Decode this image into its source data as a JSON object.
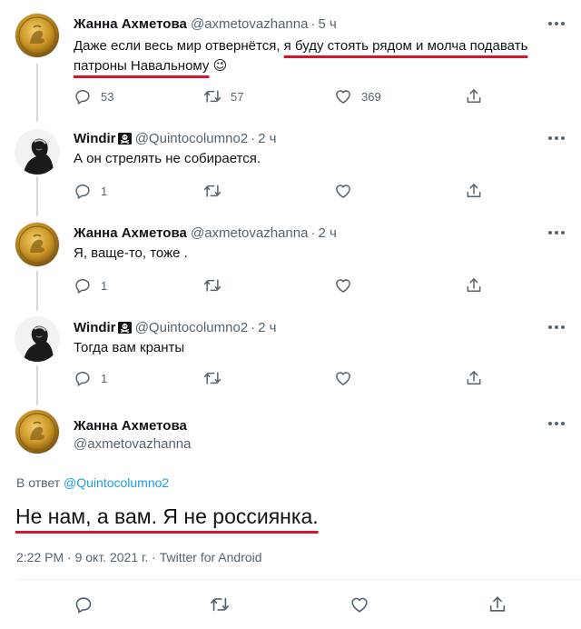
{
  "colors": {
    "accent": "#1d9bf0",
    "secondary": "#536471",
    "underline": "#d3182d"
  },
  "tweets": [
    {
      "name": "Жанна Ахметова",
      "handle": "@axmetovazhanna",
      "time": "5 ч",
      "text_before": "Даже если весь мир отвернётся, ",
      "text_underlined_1": "я буду стоять рядом и молча подавать",
      "text_underlined_2": "патроны Навальному",
      "emoji": "😉",
      "replies": "53",
      "retweets": "57",
      "likes": "369"
    },
    {
      "name": "Windir",
      "handle": "@Quintocolumno2",
      "time": "2 ч",
      "text": "А он стрелять не собирается.",
      "replies": "1"
    },
    {
      "name": "Жанна Ахметова",
      "handle": "@axmetovazhanna",
      "time": "2 ч",
      "text": "Я, ваще-то, тоже .",
      "replies": "1"
    },
    {
      "name": "Windir",
      "handle": "@Quintocolumno2",
      "time": "2 ч",
      "text": "Тогда вам кранты",
      "replies": "1"
    }
  ],
  "main_tweet": {
    "name": "Жанна Ахметова",
    "handle": "@axmetovazhanna",
    "reply_prefix": "В ответ ",
    "reply_to": "@Quintocolumno2",
    "text": "Не нам, а вам. Я не россиянка.",
    "meta": "2:22 PM · 9 окт. 2021 г. · Twitter for Android"
  },
  "icons": {
    "reply": "reply-icon",
    "retweet": "retweet-icon",
    "like": "heart-icon",
    "share": "share-icon",
    "more": "more-icon",
    "skull": "skull-crossbones-icon"
  }
}
